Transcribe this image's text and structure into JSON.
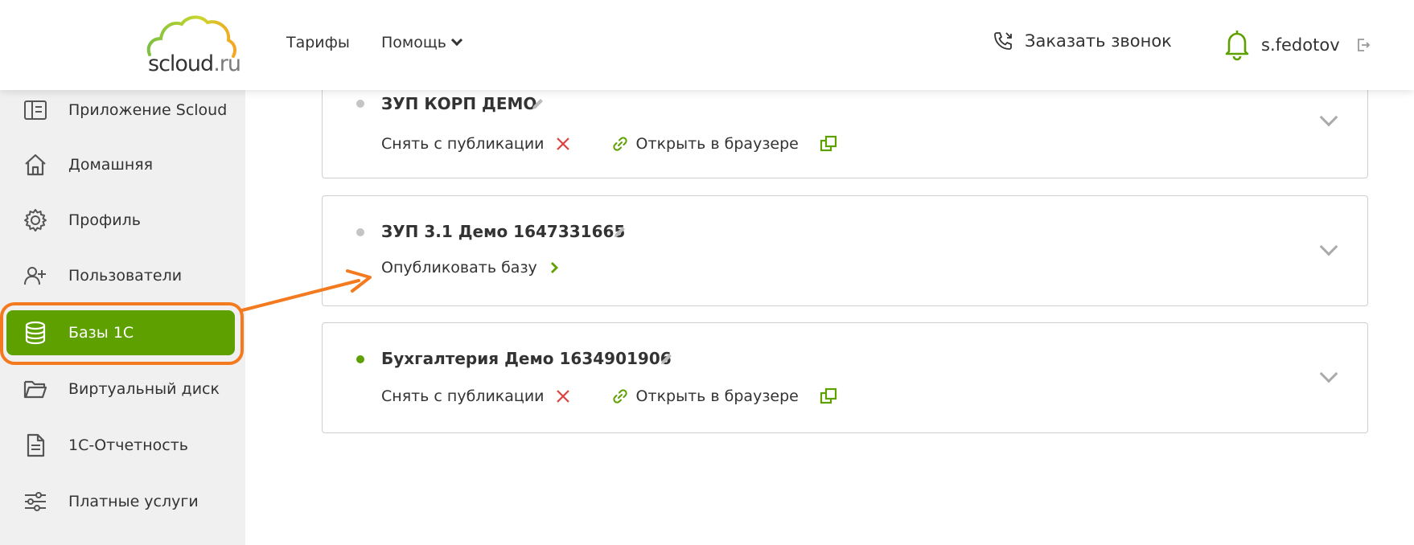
{
  "header": {
    "logo_text": "scloud",
    "logo_tld": ".ru",
    "nav": {
      "tariffs": "Тарифы",
      "help": "Помощь"
    },
    "callback_label": "Заказать звонок",
    "username": "s.fedotov"
  },
  "sidebar": {
    "items": [
      {
        "label": "Приложение Scloud",
        "icon": "app-panel-icon"
      },
      {
        "label": "Домашняя",
        "icon": "home-icon"
      },
      {
        "label": "Профиль",
        "icon": "gear-icon"
      },
      {
        "label": "Пользователи",
        "icon": "user-add-icon"
      },
      {
        "label": "Базы 1С",
        "icon": "database-icon",
        "active": true
      },
      {
        "label": "Виртуальный диск",
        "icon": "folder-icon"
      },
      {
        "label": "1С-Отчетность",
        "icon": "document-icon"
      },
      {
        "label": "Платные услуги",
        "icon": "sliders-icon"
      }
    ]
  },
  "databases": [
    {
      "title": "ЗУП КОРП ДЕМО",
      "status": "inactive",
      "unpublish": "Снять с публикации",
      "open_browser": "Открыть в браузере"
    },
    {
      "title": "ЗУП 3.1 Демо 1647331665",
      "status": "inactive",
      "publish": "Опубликовать базу"
    },
    {
      "title": "Бухгалтерия Демо 1634901906",
      "status": "active",
      "unpublish": "Снять с публикации",
      "open_browser": "Открыть в браузере"
    }
  ],
  "colors": {
    "accent_green": "#5da000",
    "highlight_orange": "#f47a1f",
    "danger_red": "#e04040",
    "inactive_dot": "#c4c4c4"
  }
}
